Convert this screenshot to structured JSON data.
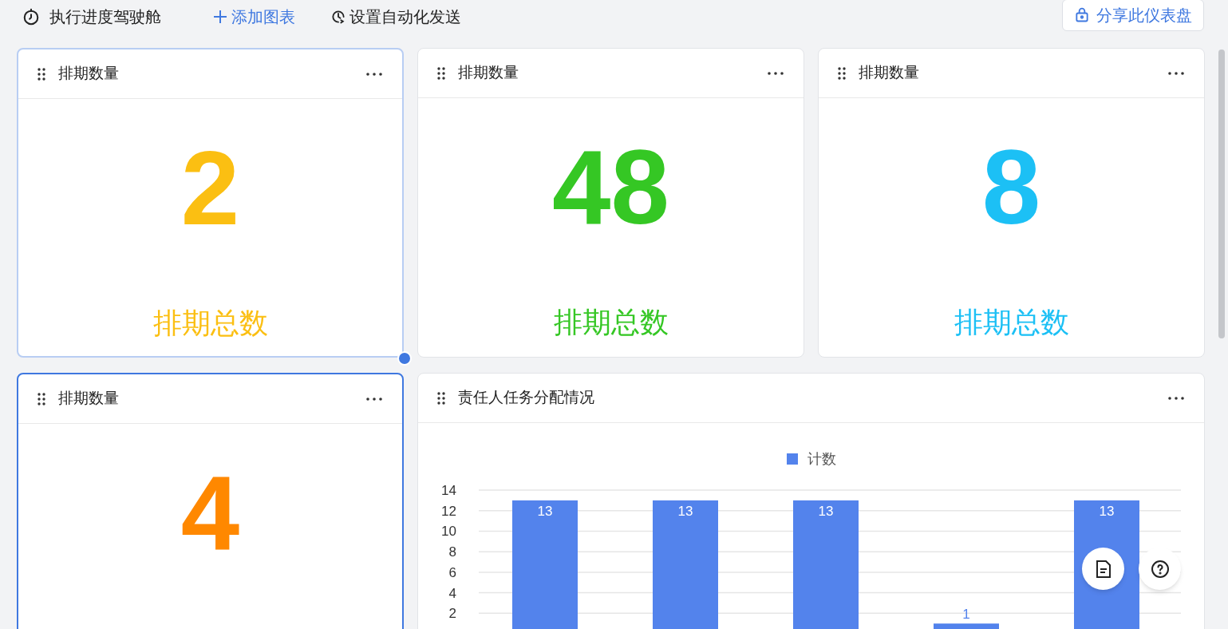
{
  "toolbar": {
    "title": "执行进度驾驶舱",
    "add_chart": "添加图表",
    "automation": "设置自动化发送",
    "share": "分享此仪表盘"
  },
  "cards": [
    {
      "title": "排期数量",
      "value": "2",
      "label": "排期总数",
      "color": "#fbbf12",
      "hovered": true,
      "selected": false
    },
    {
      "title": "排期数量",
      "value": "48",
      "label": "排期总数",
      "color": "#35c724",
      "hovered": false,
      "selected": false
    },
    {
      "title": "排期数量",
      "value": "8",
      "label": "排期总数",
      "color": "#1cc0f5",
      "hovered": false,
      "selected": false
    },
    {
      "title": "排期数量",
      "value": "4",
      "color": "#ff8800",
      "hovered": false,
      "selected": true
    }
  ],
  "chart_card": {
    "title": "责任人任务分配情况",
    "chart_data": {
      "type": "bar",
      "series": [
        {
          "name": "计数",
          "color": "#5383ec",
          "values": [
            13,
            13,
            13,
            1,
            13
          ]
        }
      ],
      "yticks": [
        2,
        4,
        6,
        8,
        10,
        12,
        14
      ],
      "ylim": [
        0,
        14
      ],
      "grid": true,
      "data_labels": true
    }
  }
}
